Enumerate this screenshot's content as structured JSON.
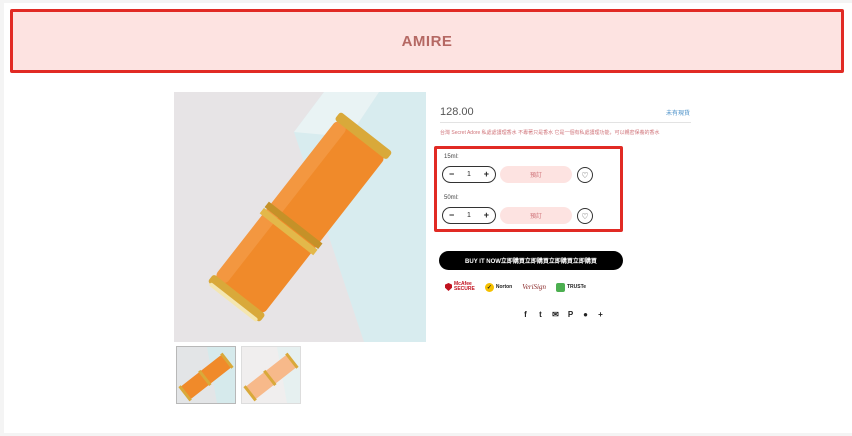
{
  "header": {
    "brand": "AMIRE"
  },
  "product": {
    "price": "128.00",
    "stock_status": "未有現貨",
    "description": "台灣 Secret Adore 私處處護理香水 不專著只是香水 它是一個有私處護理功能，可以親密保養的香水",
    "variants": [
      {
        "label": "15ml:",
        "quantity": "1",
        "button": "預訂"
      },
      {
        "label": "50ml:",
        "quantity": "1",
        "button": "預訂"
      }
    ],
    "buy_now": "BUY IT NOW立即購買立即購買立即購買立即購買",
    "badges": [
      {
        "name": "mcafee-badge",
        "text1": "McAfee",
        "text2": "SECURE"
      },
      {
        "name": "norton-badge",
        "text1": "Norton"
      },
      {
        "name": "verisign-badge",
        "text1": "VeriSign"
      },
      {
        "name": "truste-badge",
        "text1": "TRUSTe"
      }
    ],
    "social_icons": [
      "facebook-icon",
      "twitter-icon",
      "email-icon",
      "pinterest-icon",
      "messenger-icon",
      "more-icon"
    ]
  },
  "colors": {
    "header_bg": "#fde3e1",
    "highlight_border": "#e12a24",
    "brand_text": "#b56863",
    "accent_pink": "#d0747a",
    "product_orange": "#f08a2a",
    "gold": "#d9a93a"
  }
}
